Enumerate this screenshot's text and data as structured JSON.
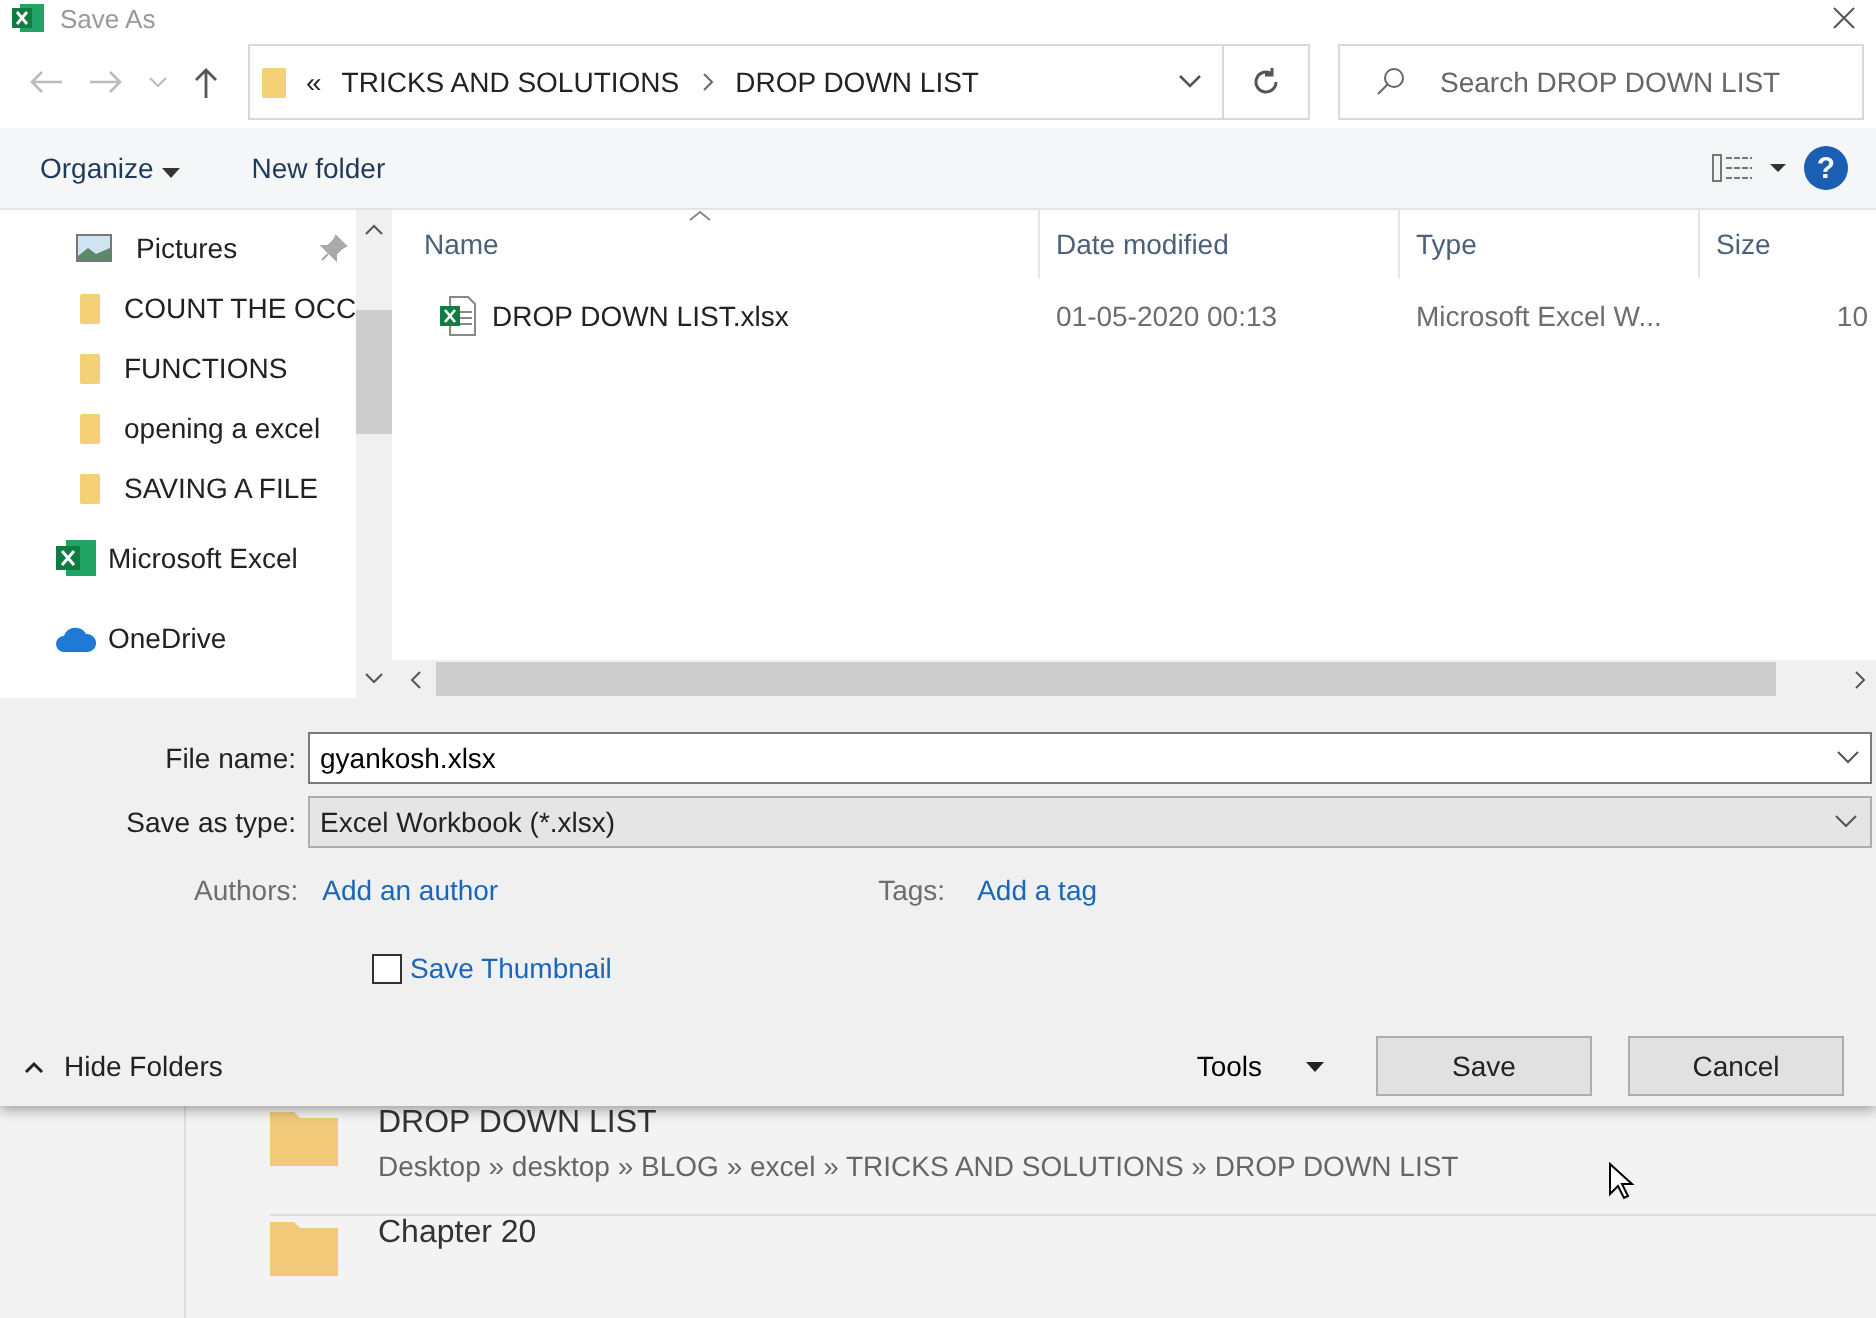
{
  "window": {
    "title": "Save As"
  },
  "address": {
    "overflow": "«",
    "crumbs": [
      "TRICKS AND SOLUTIONS",
      "DROP DOWN LIST"
    ]
  },
  "search": {
    "placeholder": "Search DROP DOWN LIST"
  },
  "toolbar": {
    "organize": "Organize",
    "new_folder": "New folder",
    "help": "?"
  },
  "sidebar": {
    "items": [
      {
        "label": "Pictures",
        "kind": "pictures",
        "pinned": true
      },
      {
        "label": "COUNT THE OCC",
        "kind": "folder",
        "pinned": false
      },
      {
        "label": "FUNCTIONS",
        "kind": "folder",
        "pinned": false
      },
      {
        "label": "opening a excel",
        "kind": "folder",
        "pinned": false
      },
      {
        "label": "SAVING A FILE",
        "kind": "folder",
        "pinned": false
      },
      {
        "label": "Microsoft Excel",
        "kind": "excel",
        "pinned": false
      },
      {
        "label": "OneDrive",
        "kind": "onedrive",
        "pinned": false
      }
    ]
  },
  "table": {
    "columns": [
      {
        "label": "Name",
        "sorted": true
      },
      {
        "label": "Date modified",
        "sorted": false
      },
      {
        "label": "Type",
        "sorted": false
      },
      {
        "label": "Size",
        "sorted": false
      }
    ],
    "rows": [
      {
        "name": "DROP DOWN LIST.xlsx",
        "date": "01-05-2020 00:13",
        "type": "Microsoft Excel W...",
        "size": "10"
      }
    ]
  },
  "form": {
    "file_name_label": "File name:",
    "file_name": "gyankosh.xlsx",
    "type_label": "Save as type:",
    "type_value": "Excel Workbook (*.xlsx)",
    "authors_label": "Authors:",
    "authors_link": "Add an author",
    "tags_label": "Tags:",
    "tags_link": "Add a tag",
    "thumbnail": {
      "label": "Save Thumbnail",
      "checked": false
    }
  },
  "footer": {
    "hide_folders": "Hide Folders",
    "tools": "Tools",
    "buttons": [
      "Save",
      "Cancel"
    ]
  },
  "background_list": [
    {
      "name": "DROP DOWN LIST",
      "path": "Desktop » desktop » BLOG » excel » TRICKS AND SOLUTIONS » DROP DOWN LIST"
    },
    {
      "name": "Chapter 20"
    }
  ]
}
